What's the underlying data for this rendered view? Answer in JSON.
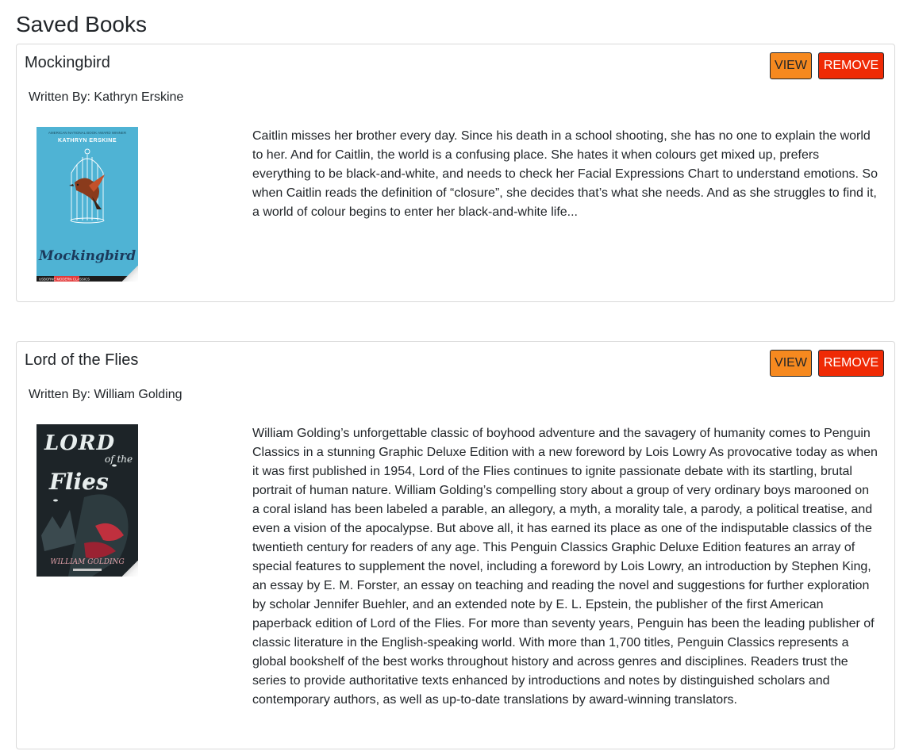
{
  "page": {
    "title": "Saved Books"
  },
  "buttons": {
    "view_label": "VIEW",
    "remove_label": "REMOVE"
  },
  "colors": {
    "view_button": "#f6891f",
    "remove_button": "#ef2a05"
  },
  "books": [
    {
      "title": "Mockingbird",
      "author_line": "Written By: Kathryn Erskine",
      "cover": {
        "top_text": "AMERICAN NATIONAL BOOK AWARD WINNER",
        "author": "KATHRYN ERSKINE",
        "title_script": "Mockingbird",
        "publisher": "USBORNE MODERN CLASSICS"
      },
      "description": "Caitlin misses her brother every day. Since his death in a school shooting, she has no one to explain the world to her. And for Caitlin, the world is a confusing place. She hates it when colours get mixed up, prefers everything to be black-and-white, and needs to check her Facial Expressions Chart to understand emotions. So when Caitlin reads the definition of “closure”, she decides that’s what she needs. And as she struggles to find it, a world of colour begins to enter her black-and-white life..."
    },
    {
      "title": "Lord of the Flies",
      "author_line": "Written By: William Golding",
      "cover": {
        "title_art": "LORD of the FLIES",
        "author": "WILLIAM GOLDING"
      },
      "description": "William Golding’s unforgettable classic of boyhood adventure and the savagery of humanity comes to Penguin Classics in a stunning Graphic Deluxe Edition with a new foreword by Lois Lowry As provocative today as when it was first published in 1954, Lord of the Flies continues to ignite passionate debate with its startling, brutal portrait of human nature. William Golding’s compelling story about a group of very ordinary boys marooned on a coral island has been labeled a parable, an allegory, a myth, a morality tale, a parody, a political treatise, and even a vision of the apocalypse. But above all, it has earned its place as one of the indisputable classics of the twentieth century for readers of any age. This Penguin Classics Graphic Deluxe Edition features an array of special features to supplement the novel, including a foreword by Lois Lowry, an introduction by Stephen King, an essay by E. M. Forster, an essay on teaching and reading the novel and suggestions for further exploration by scholar Jennifer Buehler, and an extended note by E. L. Epstein, the publisher of the first American paperback edition of Lord of the Flies. For more than seventy years, Penguin has been the leading publisher of classic literature in the English-speaking world. With more than 1,700 titles, Penguin Classics represents a global bookshelf of the best works throughout history and across genres and disciplines. Readers trust the series to provide authoritative texts enhanced by introductions and notes by distinguished scholars and contemporary authors, as well as up-to-date translations by award-winning translators."
    }
  ]
}
